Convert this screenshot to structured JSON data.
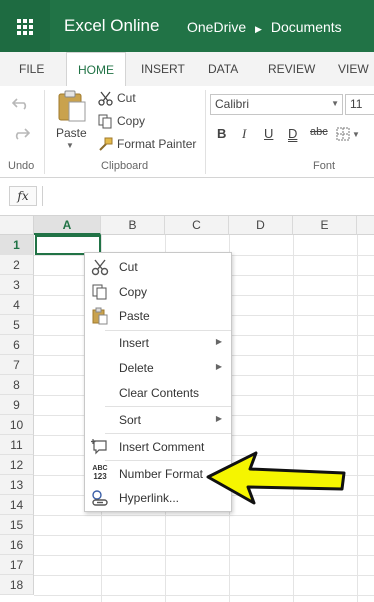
{
  "app": {
    "title": "Excel Online",
    "breadcrumb": [
      "OneDrive",
      "Documents"
    ],
    "accent": "#217346"
  },
  "tabs": [
    {
      "label": "FILE"
    },
    {
      "label": "HOME",
      "active": true
    },
    {
      "label": "INSERT"
    },
    {
      "label": "DATA"
    },
    {
      "label": "REVIEW"
    },
    {
      "label": "VIEW"
    }
  ],
  "ribbon": {
    "paste_label": "Paste",
    "cut_label": "Cut",
    "copy_label": "Copy",
    "format_painter_label": "Format Painter",
    "undo_group": "Undo",
    "clipboard_group": "Clipboard",
    "font_group": "Font",
    "font_name": "Calibri",
    "font_size": "11",
    "bold": "B",
    "italic": "I",
    "underline": "U",
    "double_underline": "D",
    "strikethrough": "abc"
  },
  "formula_bar": {
    "fx_label": "fx",
    "value": ""
  },
  "grid": {
    "columns": [
      "A",
      "B",
      "C",
      "D",
      "E"
    ],
    "rows": [
      "1",
      "2",
      "3",
      "4",
      "5",
      "6",
      "7",
      "8",
      "9",
      "10",
      "11",
      "12",
      "13",
      "14",
      "15",
      "16",
      "17",
      "18"
    ],
    "selected_cell": "A1"
  },
  "context_menu": {
    "items": [
      {
        "label": "Cut",
        "icon": "scissors-icon"
      },
      {
        "label": "Copy",
        "icon": "copy-icon"
      },
      {
        "label": "Paste",
        "icon": "paste-icon"
      },
      {
        "label": "Insert",
        "submenu": true
      },
      {
        "label": "Delete",
        "submenu": true
      },
      {
        "label": "Clear Contents"
      },
      {
        "label": "Sort",
        "submenu": true
      },
      {
        "label": "Insert Comment",
        "icon": "comment-icon"
      },
      {
        "label": "Number Format",
        "icon": "number-format-icon",
        "icon_text": [
          "ABC",
          "123"
        ]
      },
      {
        "label": "Hyperlink...",
        "icon": "hyperlink-icon"
      }
    ]
  },
  "annotation": {
    "arrow_color": "#f5f500"
  }
}
